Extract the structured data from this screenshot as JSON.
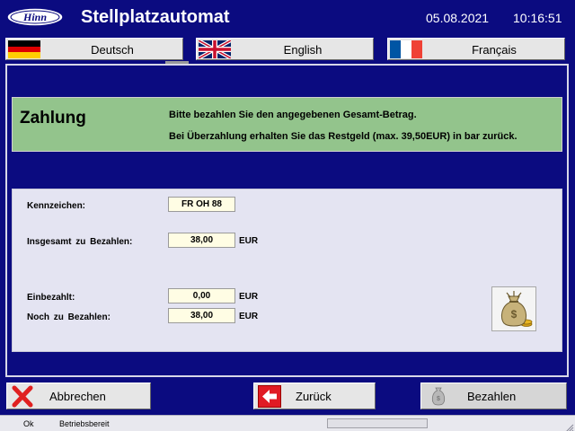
{
  "header": {
    "logo_text": "Hinn",
    "title": "Stellplatzautomat",
    "date": "05.08.2021",
    "time": "10:16:51"
  },
  "languages": [
    {
      "label": "Deutsch",
      "flag": "de-flag-icon"
    },
    {
      "label": "English",
      "flag": "uk-flag-icon"
    },
    {
      "label": "Français",
      "flag": "fr-flag-icon"
    }
  ],
  "payment": {
    "title": "Zahlung",
    "message_line1": "Bitte bezahlen Sie den angegebenen Gesamt-Betrag.",
    "message_line2": "Bei Überzahlung erhalten Sie das Restgeld (max. 39,50EUR) in bar zurück.",
    "panel_color": "#93c48c"
  },
  "details": {
    "plate_label": "Kennzeichen:",
    "plate_value": "FR OH 88",
    "total_label": "Insgesamt zu Bezahlen:",
    "total_value": "38,00",
    "total_unit": "EUR",
    "paid_label": "Einbezahlt:",
    "paid_value": "0,00",
    "paid_unit": "EUR",
    "due_label": "Noch zu Bezahlen:",
    "due_value": "38,00",
    "due_unit": "EUR",
    "icon": "money-bag-icon"
  },
  "actions": {
    "cancel_label": "Abbrechen",
    "cancel_icon": "red-x-icon",
    "back_label": "Zurück",
    "back_icon": "arrow-left-icon",
    "pay_label": "Bezahlen",
    "pay_icon": "money-bag-icon"
  },
  "status": {
    "state": "Ok",
    "message": "Betriebsbereit"
  },
  "colors": {
    "background": "#0b0b80",
    "panel": "#e4e4f2",
    "value_field": "#fffde4"
  }
}
